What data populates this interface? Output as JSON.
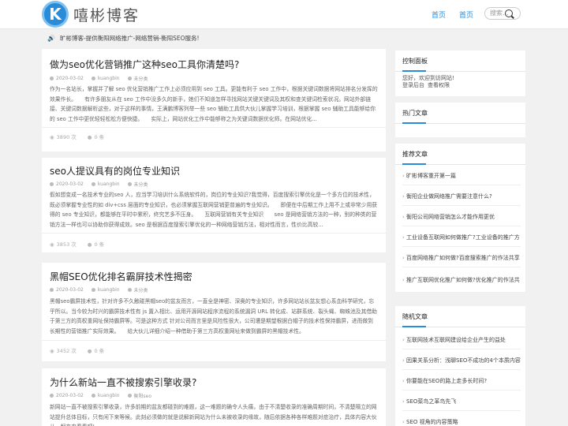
{
  "header": {
    "logo_letter": "K",
    "logo_text": "嘻彬博客",
    "nav": [
      "首页",
      "首页"
    ],
    "search_placeholder": "搜索..."
  },
  "notice": "旷彬博客-提供衡阳网络推广-网络营销-衡阳SEO服务!",
  "posts": [
    {
      "title": "做为seo优化营销推广这种seo工具你清楚吗?",
      "date": "2020-03-02",
      "author": "kuangbin",
      "category": "未分类",
      "excerpt": "作为一名站长，掌握并了解 seo 优化营销推广工作上必须应用到 seo 工具。更能有利于 seo 工作中，根据关键词数据将网站排名分发挥的效果作长。　　有许多朋友从在 seo 工作中没多久的新手，她们不知道怎样寻找网站关键关键词及其权和查关键词检索状况。网站外部链接、关键词数据解析这些，对于这样的事情，王满鹏博客列举一些 seo 辅助工具供大伙儿掌握学习培训，根据掌握 seo 辅助工具能够给你的 seo 工作中更优轻轻松松方便快捷。　　实际上，网站优化工作中能够称之为关键词数据优化师。在网站优化...",
      "views": "3890 次",
      "comments": "0 条"
    },
    {
      "title": "seo人提议具有的岗位专业知识",
      "date": "2020-03-02",
      "author": "kuangbin",
      "category": "未分类",
      "excerpt": "假如想变成一名技术专业的seo 人，应当学习培训什么系统软件的，岗位的专业知识?我觉得，百度搜索引擎优化是一个多方位的技术性，既必须掌握专业性的如 div+css 层面的专业知识，也必须掌握互联网营销更普遍的专业知识。　　即便在中后期工作上用不上或非常少用获得的 seo 专业知识，都能够在平时中累积，终究艺多不压身。　　互联网营销有关专业知识　　seo 是网络营销方法的一种，别的种类的营销方法一样也可以协助你获得成效。seo 是根据百度搜索引擎优化的一种网络营销方法，相对性而言，性价比高较...",
      "views": "3853 次",
      "comments": "0 条"
    },
    {
      "title": "黑帽SEO优化排名霸屏技术性揭密",
      "date": "2020-03-02",
      "author": "kuangbin",
      "category": "未分类",
      "excerpt": "黑帽seo霸屏技术性，针对许多不久触碰黑帽seo的盆友而言，一直全是神密、深奥的专业知识，许多网站站长盆友想心系血科学研究，忘乎所以。当今较为时兴的霸屏技术性有 js 置入相比、运用开源网站程序流程的系统漏洞 URL 转化成、站群系统、裂头蝇、蜘蛛池及其借助于第三方的高权重网址保持霸屏等。可是这种方式 针对公司而言里是风险性很大，公司遭是期望根据白帽子的技术性保持霸屏，进而做到长期性的营销推广实际效果。　　给大伙儿详细介绍一种借助于第三方高权重网址来做到霸屏的黑帽技术性。",
      "views": "3452 次",
      "comments": "0 条"
    },
    {
      "title": "为什么新站一直不被搜索引擎收录?",
      "date": "2020-03-02",
      "author": "kuangbin",
      "category": "衡阳seo",
      "excerpt": "新网站一直不被搜索引擎收录，许多前期的盆友都碰到的难题，这一难题的确令人头痛，由于不清楚收录的准确周期时间，不清楚隔立的网站提升总体目标，只有闲下来等候。此刻必须做的就是说解新网站为什么未被收录的缘故，随后依据各种各样难题对症治疗，具体内容大伙儿一起来来看看吧!",
      "views": "",
      "comments": ""
    }
  ],
  "sidebar": {
    "control": {
      "title": "控制面板",
      "greeting": "您好，欢迎到访网站!",
      "login": "登录后台",
      "view_permission": "查看权限"
    },
    "hot": {
      "title": "热门文章"
    },
    "recommended": {
      "title": "推荐文章",
      "items": [
        "旷彬博客重开第一篇",
        "衡阳企业做网络推广需要注意什么?",
        "衡阳公司网络营销怎么才能作用更优",
        "工业设备互联网如何做推广?工业设备的推广方",
        "百度网络推广如何做?百度搜索推广的作法共享",
        "推广互联网优化推广如何做?优化推广的作法共"
      ]
    },
    "random": {
      "title": "随机文章",
      "items": [
        "互联网技术互联网建设给企业产生的益处",
        "因果关系分析：浅聊SEO不成功的4个本质内容",
        "你要能在SEO的路上走多长时间?",
        "SEO菜鸟之革鸟先飞",
        "SEO 视角的内容策略"
      ]
    }
  }
}
